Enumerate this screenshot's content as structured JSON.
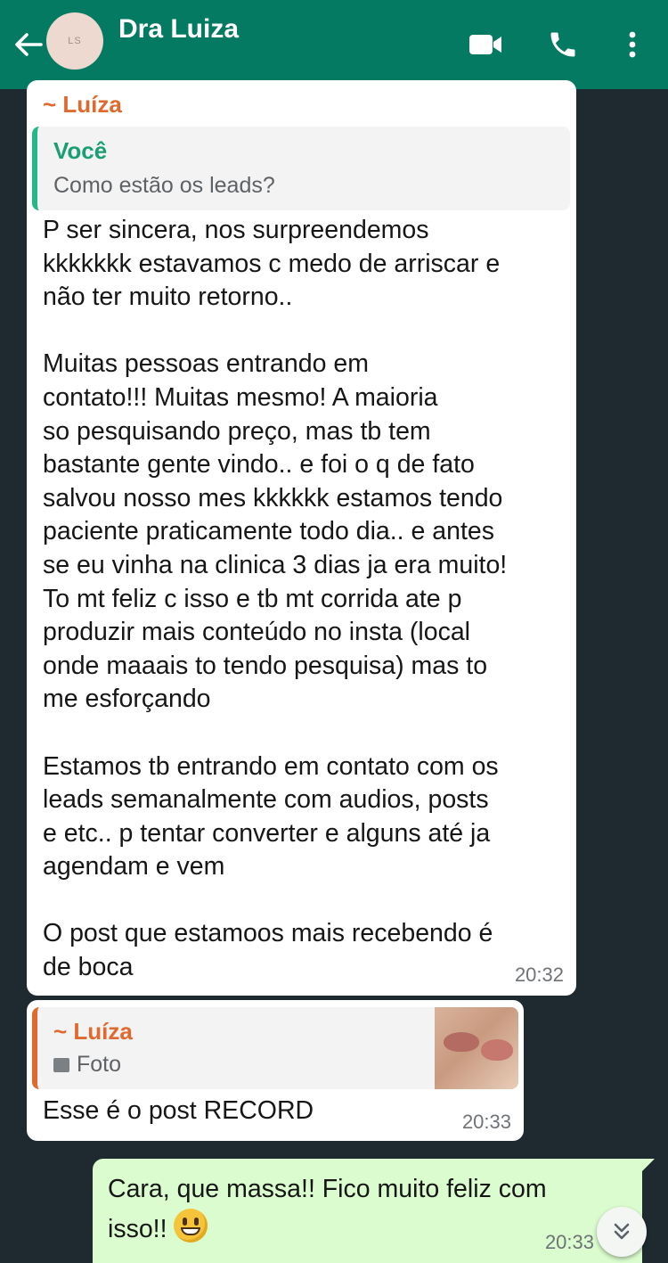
{
  "header": {
    "contact_name": "Dra Luiza",
    "avatar_text": "LS",
    "icons": [
      "back-arrow-icon",
      "video-call-icon",
      "phone-icon",
      "more-vert-icon"
    ],
    "bg_color": "#047a63"
  },
  "messages": [
    {
      "sender": "~ Luíza",
      "quoted_name": "Você",
      "quoted_text": "Como estão  os leads?",
      "text": "P ser sincera, nos surpreendemos\nkkkkkkk estavamos c medo de arriscar e\nnão ter muito retorno..\n\nMuitas pessoas entrando em\ncontato!!! Muitas mesmo! A maioria\nso pesquisando preço, mas tb tem\nbastante gente vindo.. e foi o q de fato\nsalvou nosso mes kkkkkk estamos tendo\npaciente praticamente todo dia.. e antes\nse eu vinha na clinica 3 dias ja era muito!\nTo mt feliz c isso e tb mt corrida ate p\nproduzir mais conteúdo no insta (local\nonde maaais to tendo pesquisa) mas to\nme esforçando\n\nEstamos tb entrando em contato com os\nleads semanalmente com audios, posts\ne etc.. p tentar converter e alguns até ja\nagendam e vem\n\nO post que estamoos mais recebendo é\nde boca",
      "time": "20:32"
    },
    {
      "quoted_name": "~ Luíza",
      "quoted_text": "Foto",
      "text": "Esse é o post RECORD",
      "time": "20:33"
    },
    {
      "text": "Cara, que massa!! Fico muito feliz com isso!!",
      "time": "20:33"
    }
  ],
  "colors": {
    "chat_bg": "#1f2a30",
    "incoming_bubble": "#ffffff",
    "outgoing_bubble": "#dafcce",
    "sender_orange": "#e0692f",
    "quote_green": "#1a9e74"
  }
}
